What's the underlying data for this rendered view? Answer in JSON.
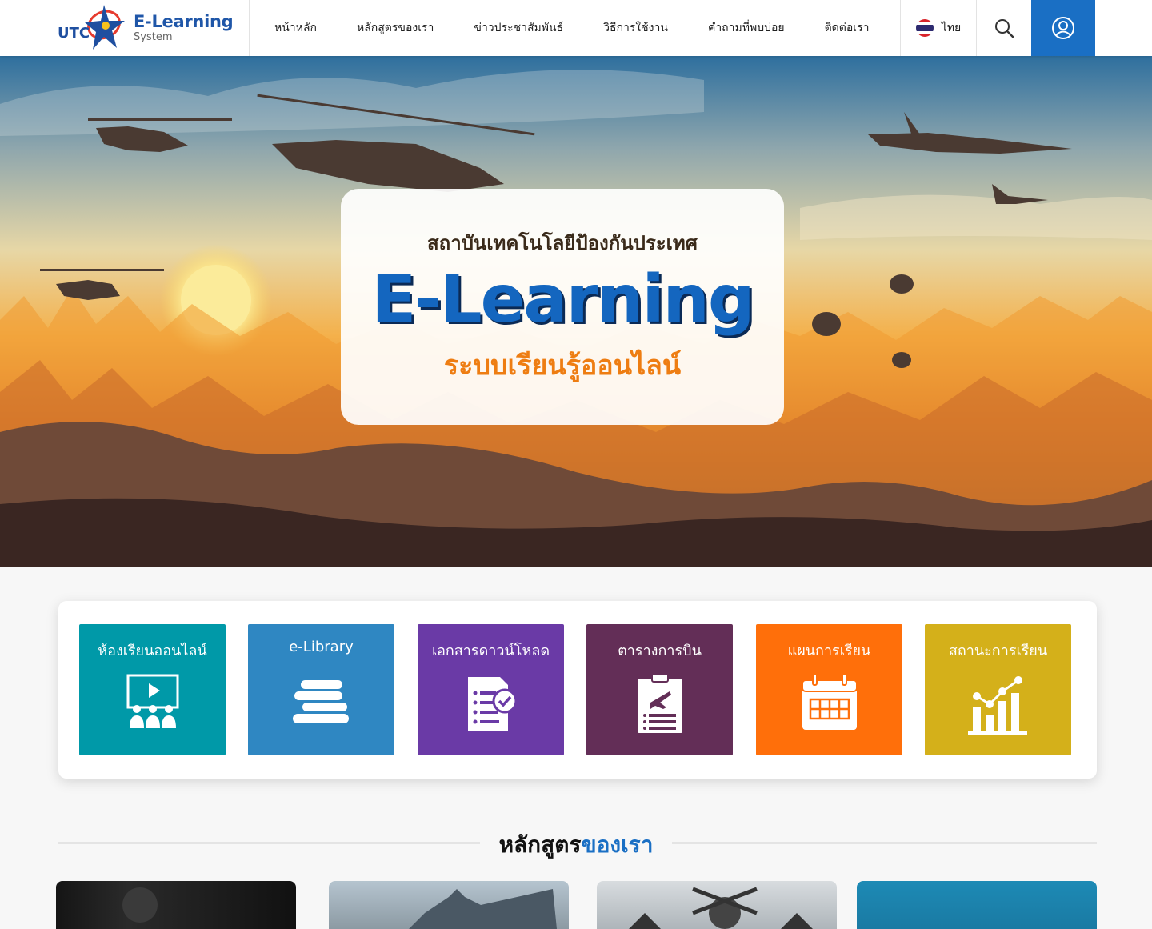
{
  "header": {
    "logo_text": "UTC",
    "title": "E-Learning",
    "subtitle": "System",
    "nav": [
      {
        "label": "หน้าหลัก"
      },
      {
        "label": "หลักสูตรของเรา"
      },
      {
        "label": "ข่าวประชาสัมพันธ์"
      },
      {
        "label": "วิธีการใช้งาน"
      },
      {
        "label": "คำถามที่พบบ่อย"
      },
      {
        "label": "ติดต่อเรา"
      }
    ],
    "language": "ไทย",
    "icons": {
      "search": "search-icon",
      "user": "user-icon",
      "flag": "thai-flag-icon"
    },
    "accent_color": "#1a6fc4"
  },
  "hero": {
    "top_text": "สถาบันเทคโนโลยีป้องกันประเทศ",
    "main_text": "E-Learning",
    "bottom_text": "ระบบเรียนรู้ออนไลน์"
  },
  "menu": [
    {
      "label": "ห้องเรียนออนไลน์",
      "color": "#0099a8",
      "icon": "classroom-icon"
    },
    {
      "label": "e-Library",
      "color": "#2f87c2",
      "icon": "books-icon"
    },
    {
      "label": "เอกสารดาวน์โหลด",
      "color": "#6a3aa6",
      "icon": "document-check-icon"
    },
    {
      "label": "ตารางการบิน",
      "color": "#632e57",
      "icon": "flight-schedule-icon"
    },
    {
      "label": "แผนการเรียน",
      "color": "#ff6f0a",
      "icon": "calendar-icon"
    },
    {
      "label": "สถานะการเรียน",
      "color": "#d4b01a",
      "icon": "progress-chart-icon"
    }
  ],
  "section": {
    "title_part1": "หลักสูตร",
    "title_part2": "ของเรา"
  }
}
